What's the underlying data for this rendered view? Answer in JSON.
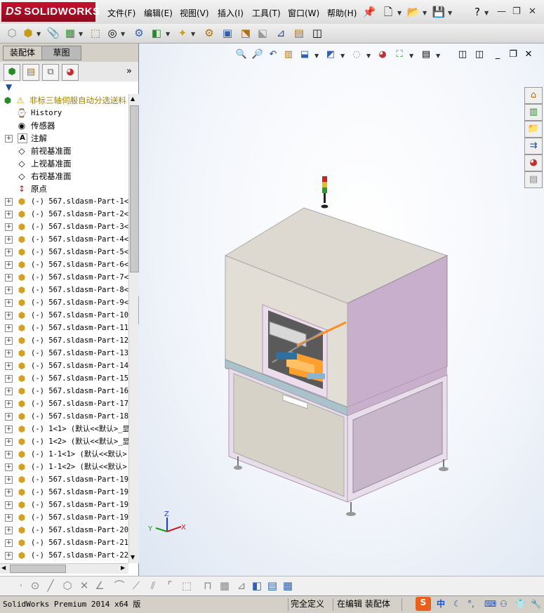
{
  "app": {
    "logo_text": "SOLIDWORKS",
    "logo_prefix": "DS"
  },
  "menu": [
    "文件(F)",
    "编辑(E)",
    "视图(V)",
    "插入(I)",
    "工具(T)",
    "窗口(W)",
    "帮助(H)"
  ],
  "tabs": {
    "assembly": "装配体",
    "sketch": "草图"
  },
  "tree": {
    "root": "非标三轴伺服自动分选送料",
    "history": "History",
    "sensors": "传感器",
    "annotations": "注解",
    "front_plane": "前视基准面",
    "top_plane": "上视基准面",
    "right_plane": "右视基准面",
    "origin": "原点",
    "parts": [
      "(-) 567.sldasm-Part-1<1",
      "(-) 567.sldasm-Part-2<1",
      "(-) 567.sldasm-Part-3<1",
      "(-) 567.sldasm-Part-4<1",
      "(-) 567.sldasm-Part-5<1",
      "(-) 567.sldasm-Part-6<1",
      "(-) 567.sldasm-Part-7<1",
      "(-) 567.sldasm-Part-8<1",
      "(-) 567.sldasm-Part-9<1",
      "(-) 567.sldasm-Part-10<",
      "(-) 567.sldasm-Part-11<",
      "(-) 567.sldasm-Part-12<",
      "(-) 567.sldasm-Part-13<",
      "(-) 567.sldasm-Part-14<",
      "(-) 567.sldasm-Part-15<",
      "(-) 567.sldasm-Part-16<",
      "(-) 567.sldasm-Part-17<",
      "(-) 567.sldasm-Part-18<",
      "(-) 1<1> (默认<<默认>_显",
      "(-) 1<2> (默认<<默认>_显",
      "(-) 1-1<1> (默认<<默认>",
      "(-) 1-1<2> (默认<<默认>",
      "(-) 567.sldasm-Part-19<",
      "(-) 567.sldasm-Part-19<",
      "(-) 567.sldasm-Part-19<",
      "(-) 567.sldasm-Part-19<",
      "(-) 567.sldasm-Part-20<",
      "(-) 567.sldasm-Part-21<",
      "(-) 567.sldasm-Part-22<"
    ]
  },
  "triad": {
    "x": "X",
    "y": "Y",
    "z": "Z"
  },
  "status": {
    "version": "SolidWorks Premium 2014 x64 版",
    "definition": "完全定义",
    "mode": "在编辑 装配体",
    "ime": "中"
  },
  "colors": {
    "brand": "#c8102e",
    "machine_frame": "#e6d2e6",
    "machine_panel": "#dcd9d1",
    "accent": "#ff9a2e"
  }
}
